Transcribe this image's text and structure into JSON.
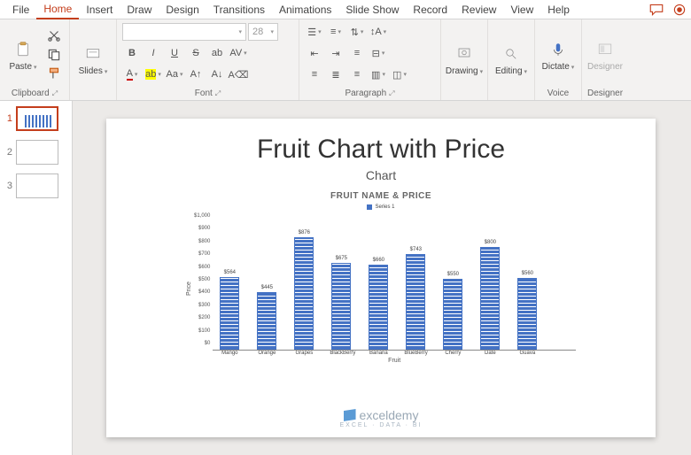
{
  "menus": {
    "file": "File",
    "home": "Home",
    "insert": "Insert",
    "draw": "Draw",
    "design": "Design",
    "transitions": "Transitions",
    "animations": "Animations",
    "slideshow": "Slide Show",
    "record": "Record",
    "review": "Review",
    "view": "View",
    "help": "Help"
  },
  "ribbon": {
    "clipboard": {
      "label": "Clipboard",
      "paste": "Paste"
    },
    "slides": {
      "label": "Slides",
      "btn": "Slides"
    },
    "font": {
      "label": "Font",
      "size": "28"
    },
    "paragraph": {
      "label": "Paragraph"
    },
    "drawing": {
      "label": "Drawing",
      "btn": "Drawing"
    },
    "editing": {
      "label": "Editing",
      "btn": "Editing"
    },
    "voice": {
      "label": "Voice",
      "btn": "Dictate"
    },
    "designer": {
      "label": "Designer",
      "btn": "Designer"
    }
  },
  "thumbs": [
    "1",
    "2",
    "3"
  ],
  "slide": {
    "title": "Fruit Chart with Price",
    "subtitle": "Chart",
    "chart_title": "FRUIT NAME & PRICE",
    "legend": "Series 1",
    "xlabel": "Fruit",
    "ylabel": "Price"
  },
  "chart_data": {
    "type": "bar",
    "title": "FRUIT NAME & PRICE",
    "xlabel": "Fruit",
    "ylabel": "Price",
    "ylim": [
      0,
      1000
    ],
    "yticks": [
      "$1,000",
      "$900",
      "$800",
      "$700",
      "$600",
      "$500",
      "$400",
      "$300",
      "$200",
      "$100",
      "$0"
    ],
    "categories": [
      "Mango",
      "Orange",
      "Grapes",
      "BlackBerry",
      "Banana",
      "BlueBerry",
      "Cherry",
      "Date",
      "Guava"
    ],
    "values": [
      564,
      445,
      876,
      675,
      660,
      743,
      550,
      800,
      560
    ],
    "value_labels": [
      "$564",
      "$445",
      "$876",
      "$675",
      "$660",
      "$743",
      "$550",
      "$800",
      "$560"
    ],
    "series": [
      {
        "name": "Series 1",
        "color": "#4472c4"
      }
    ]
  },
  "watermark": {
    "brand": "exceldemy",
    "tag": "EXCEL · DATA · BI"
  }
}
